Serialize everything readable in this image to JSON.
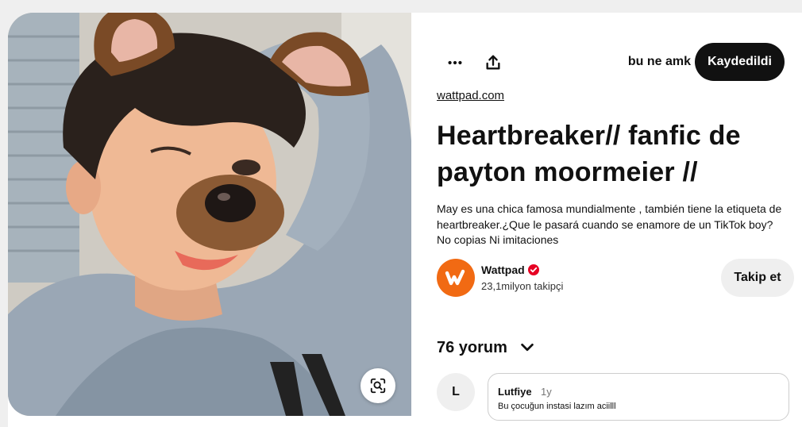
{
  "pin": {
    "board_name": "bu ne amk",
    "save_label": "Kaydedildi",
    "source": "wattpad.com",
    "title": "Heartbreaker// fanfic de payton moormeier //",
    "description": "May es una chica famosa mundialmente , también tiene la etiqueta de heartbreaker.¿Que le pasará cuando se enamore de un TikTok boy? No copias Ni imitaciones"
  },
  "creator": {
    "name": "Wattpad",
    "followers": "23,1milyon takipçi",
    "follow_label": "Takip et",
    "avatar_color": "#f16a13"
  },
  "comments": {
    "count_label": "76 yorum",
    "items": [
      {
        "avatar_letter": "L",
        "author": "Lutfiye",
        "time": "1y",
        "text": "Bu çocuğun instasi lazım aciilll"
      }
    ]
  },
  "icons": {
    "more": "more-icon",
    "share": "share-icon",
    "lens": "visual-search-icon",
    "verified": "verified-badge-icon",
    "chevron": "chevron-down-icon"
  },
  "colors": {
    "save_button": "#111111",
    "brand": "#f16a13",
    "verified": "#e60023"
  }
}
